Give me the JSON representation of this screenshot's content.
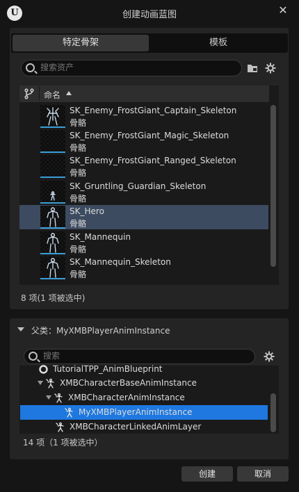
{
  "window": {
    "title": "创建动画蓝图",
    "close_glyph": "✕"
  },
  "tabs": [
    {
      "label": "特定骨架",
      "selected": true
    },
    {
      "label": "模板",
      "selected": false
    }
  ],
  "asset_search": {
    "placeholder": "搜索资产"
  },
  "asset_list": {
    "column_name": "命名",
    "sort": "ascending",
    "rows": [
      {
        "name": "SK_Enemy_FrostGiant_Captain_Skeleton",
        "type": "骨骼",
        "selected": false,
        "thumb": "frost-giant-captain"
      },
      {
        "name": "SK_Enemy_FrostGiant_Magic_Skeleton",
        "type": "骨骼",
        "selected": false,
        "thumb": "none"
      },
      {
        "name": "SK_Enemy_FrostGiant_Ranged_Skeleton",
        "type": "骨骼",
        "selected": false,
        "thumb": "none"
      },
      {
        "name": "SK_Gruntling_Guardian_Skeleton",
        "type": "骨骼",
        "selected": false,
        "thumb": "gruntling"
      },
      {
        "name": "SK_Hero",
        "type": "骨骼",
        "selected": true,
        "thumb": "humanoid"
      },
      {
        "name": "SK_Mannequin",
        "type": "骨骼",
        "selected": false,
        "thumb": "humanoid"
      },
      {
        "name": "SK_Mannequin_Skeleton",
        "type": "骨骼",
        "selected": false,
        "thumb": "humanoid"
      }
    ],
    "count_text": "8 项(1 项被选中)"
  },
  "parent_class": {
    "label": "父类：MyXMBPlayerAnimInstance",
    "search_placeholder": "搜索",
    "items": [
      {
        "label": "TutorialTPP_AnimBlueprint",
        "icon": "blueprint-ring-icon",
        "selected": false
      },
      {
        "label": "XMBCharacterBaseAnimInstance",
        "icon": "anim-class-icon",
        "expanded": true,
        "selected": false
      },
      {
        "label": "XMBCharacterAnimInstance",
        "icon": "anim-class-icon",
        "expanded": true,
        "selected": false
      },
      {
        "label": "MyXMBPlayerAnimInstance",
        "icon": "anim-class-icon",
        "selected": true
      },
      {
        "label": "XMBCharacterLinkedAnimLayer",
        "icon": "anim-class-icon",
        "selected": false
      }
    ],
    "count_text": "14 项（1 项被选中）"
  },
  "buttons": {
    "create": "创建",
    "cancel": "取消"
  },
  "colors": {
    "selection_row": "#3c4b60",
    "selection_class": "#1e78e0",
    "thumb_bar": "#3a9ed8",
    "panel": "#242424",
    "background": "#151515"
  }
}
